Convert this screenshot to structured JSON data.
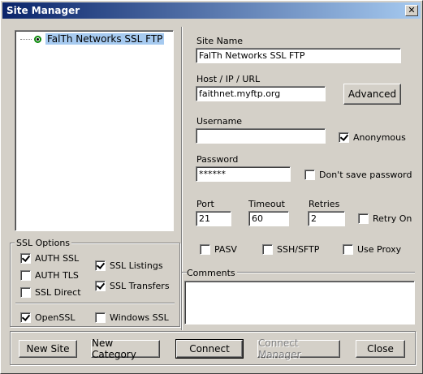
{
  "window": {
    "title": "Site Manager",
    "close_glyph": "✕"
  },
  "tree": {
    "items": [
      {
        "label": "FalTh Networks SSL FTP",
        "icon": "site-icon"
      }
    ]
  },
  "ssl_options": {
    "title": "SSL Options",
    "auth_ssl": "AUTH SSL",
    "auth_tls": "AUTH TLS",
    "ssl_direct": "SSL Direct",
    "ssl_listings": "SSL Listings",
    "ssl_transfers": "SSL Transfers",
    "openssl": "OpenSSL",
    "windows_ssl": "Windows SSL"
  },
  "form": {
    "site_name_label": "Site Name",
    "site_name_value": "FalTh Networks SSL FTP",
    "host_label": "Host / IP / URL",
    "host_value": "faithnet.myftp.org",
    "advanced_button": "Advanced",
    "username_label": "Username",
    "username_value": "",
    "anonymous_label": "Anonymous",
    "password_label": "Password",
    "password_value": "******",
    "dont_save_label": "Don't save password",
    "port_label": "Port",
    "port_value": "21",
    "timeout_label": "Timeout",
    "timeout_value": "60",
    "retries_label": "Retries",
    "retries_value": "2",
    "retry_on_label": "Retry On",
    "pasv_label": "PASV",
    "sshsftp_label": "SSH/SFTP",
    "use_proxy_label": "Use Proxy",
    "comments_label": "Comments",
    "comments_value": ""
  },
  "buttons": {
    "new_site": "New Site",
    "new_category": "New Category",
    "connect": "Connect",
    "connect_manager": "Connect Manager",
    "close": "Close"
  }
}
